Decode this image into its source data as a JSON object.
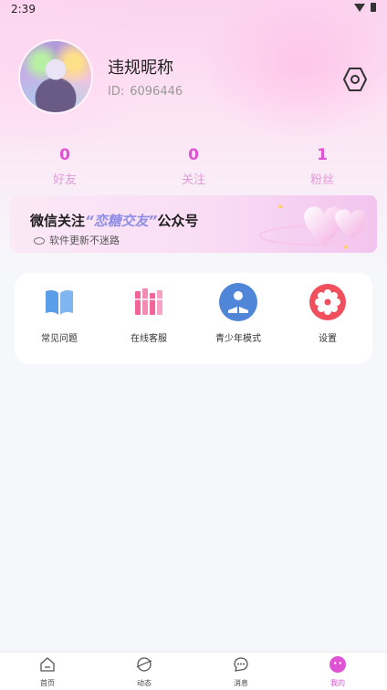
{
  "status_bar": {
    "time": "2:39"
  },
  "profile": {
    "nickname": "违规昵称",
    "id_label": "ID:",
    "id_value": "6096446"
  },
  "stats": [
    {
      "value": "0",
      "label": "好友"
    },
    {
      "value": "0",
      "label": "关注"
    },
    {
      "value": "1",
      "label": "粉丝"
    }
  ],
  "banner": {
    "title_prefix": "微信关注",
    "title_highlight": "“恋糖交友”",
    "title_suffix": "公众号",
    "subtitle": "软件更新不迷路"
  },
  "services": [
    {
      "label": "常见问题",
      "icon": "book-icon",
      "color": "#5b9ee8"
    },
    {
      "label": "在线客服",
      "icon": "books-icon",
      "color": "#f2649a"
    },
    {
      "label": "青少年模式",
      "icon": "reader-icon",
      "color": "#4f86d8"
    },
    {
      "label": "设置",
      "icon": "gear-icon",
      "color": "#f0505e"
    }
  ],
  "bottom_nav": [
    {
      "label": "首页",
      "icon": "home-icon"
    },
    {
      "label": "动态",
      "icon": "planet-icon"
    },
    {
      "label": "消息",
      "icon": "chat-icon"
    },
    {
      "label": "我的",
      "icon": "face-icon",
      "active": true
    }
  ],
  "colors": {
    "accent": "#e052d4",
    "stat_label": "#e29ad8"
  }
}
